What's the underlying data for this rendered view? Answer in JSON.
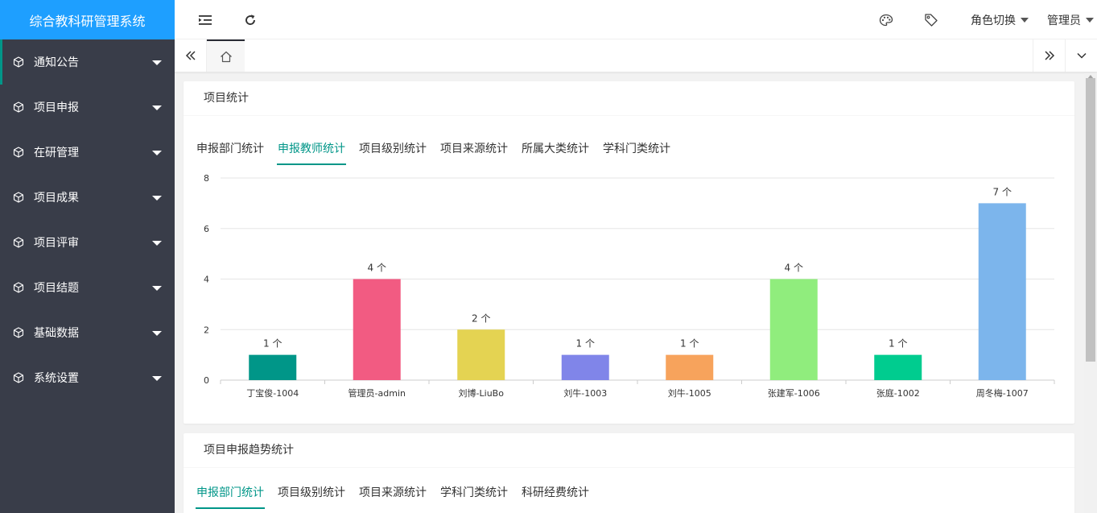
{
  "app": {
    "title": "综合教科研管理系统"
  },
  "sidebar": {
    "items": [
      {
        "label": "通知公告"
      },
      {
        "label": "项目申报"
      },
      {
        "label": "在研管理"
      },
      {
        "label": "项目成果"
      },
      {
        "label": "项目评审"
      },
      {
        "label": "项目结题"
      },
      {
        "label": "基础数据"
      },
      {
        "label": "系统设置"
      }
    ]
  },
  "header": {
    "role_switch": "角色切换",
    "user": "管理员"
  },
  "cards": {
    "project_stats": {
      "title": "项目统计",
      "tabs": [
        "申报部门统计",
        "申报教师统计",
        "项目级别统计",
        "项目来源统计",
        "所属大类统计",
        "学科门类统计"
      ],
      "active_tab": 1
    },
    "trend_stats": {
      "title": "项目申报趋势统计",
      "tabs": [
        "申报部门统计",
        "项目级别统计",
        "项目来源统计",
        "学科门类统计",
        "科研经费统计"
      ],
      "active_tab": 0
    }
  },
  "chart_data": {
    "type": "bar",
    "categories": [
      "丁宝俊-1004",
      "管理员-admin",
      "刘博-LiuBo",
      "刘牛-1003",
      "刘牛-1005",
      "张建军-1006",
      "张庭-1002",
      "周冬梅-1007"
    ],
    "values": [
      1,
      4,
      2,
      1,
      1,
      4,
      1,
      7
    ],
    "value_suffix": " 个",
    "colors": [
      "#009688",
      "#f25b82",
      "#e4d352",
      "#8085e9",
      "#f7a35c",
      "#90ed7d",
      "#00cc8f",
      "#7cb5ec"
    ],
    "ylim": [
      0,
      8
    ],
    "yticks": [
      0,
      2,
      4,
      6,
      8
    ],
    "grid": true,
    "title": "",
    "xlabel": "",
    "ylabel": ""
  }
}
